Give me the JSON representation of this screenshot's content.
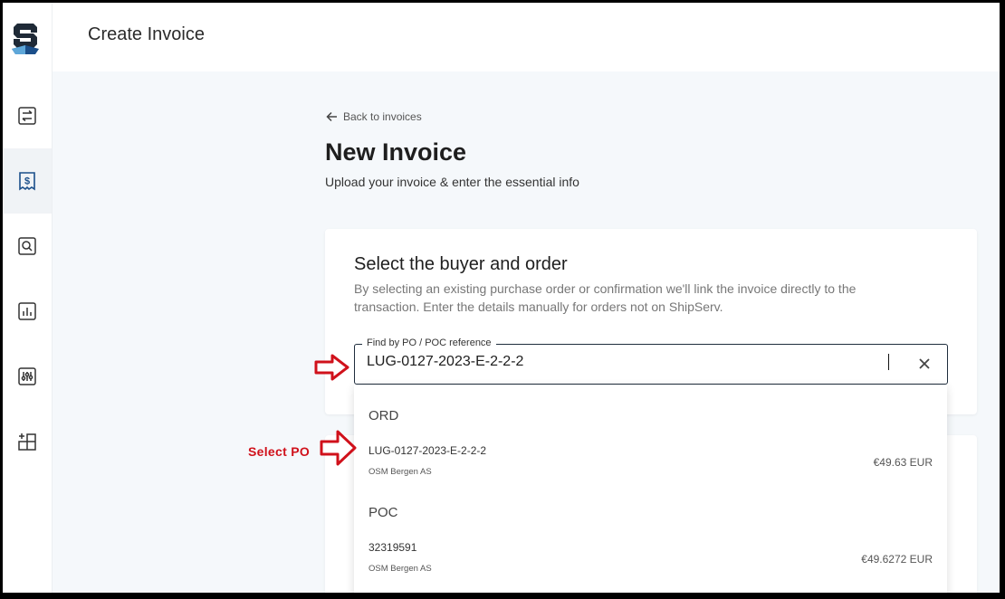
{
  "header": {
    "title": "Create Invoice"
  },
  "sidebar": {
    "items": [
      {
        "icon": "transfer-icon"
      },
      {
        "icon": "invoice-dollar-icon",
        "active": true
      },
      {
        "icon": "search-icon"
      },
      {
        "icon": "chart-icon"
      },
      {
        "icon": "sliders-icon"
      },
      {
        "icon": "add-grid-icon"
      }
    ]
  },
  "main": {
    "back_label": "Back to invoices",
    "title": "New Invoice",
    "subtitle": "Upload your invoice & enter the essential info"
  },
  "card": {
    "title": "Select the buyer and order",
    "description": "By selecting an existing purchase order or confirmation we'll link the invoice directly to the transaction. Enter the details manually for orders not on ShipServ.",
    "field_label": "Find by PO / POC reference",
    "field_value": "LUG-0127-2023-E-2-2-2"
  },
  "dropdown": {
    "groups": [
      {
        "label": "ORD",
        "options": [
          {
            "ref": "LUG-0127-2023-E-2-2-2",
            "buyer": "OSM Bergen AS",
            "amount": "€49.63 EUR"
          }
        ]
      },
      {
        "label": "POC",
        "options": [
          {
            "ref": "32319591",
            "buyer": "OSM Bergen AS",
            "amount": "€49.6272 EUR"
          }
        ]
      }
    ]
  },
  "annotations": {
    "select_po": "Select PO"
  },
  "colors": {
    "accent": "#1b4f8a",
    "annotation": "#d0111b"
  }
}
